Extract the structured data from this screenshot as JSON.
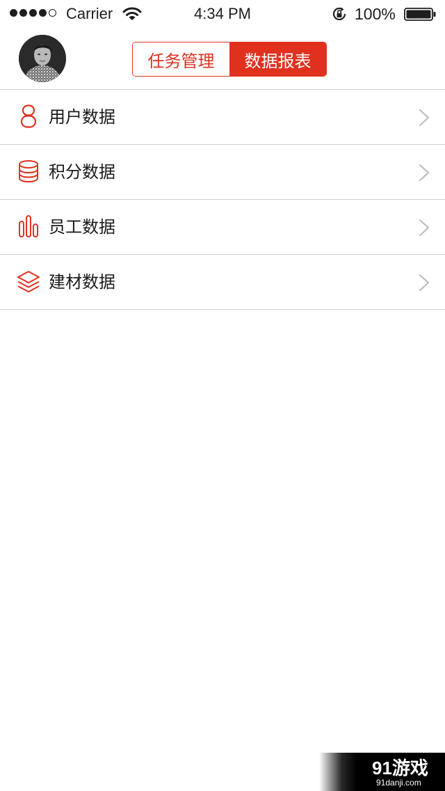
{
  "status_bar": {
    "carrier": "Carrier",
    "time": "4:34 PM",
    "battery": "100%",
    "signal_bars_filled": 4,
    "signal_bars_total": 5
  },
  "header": {
    "avatar_icon": "user-avatar-photo",
    "tabs": [
      {
        "label": "任务管理",
        "active": false
      },
      {
        "label": "数据报表",
        "active": true
      }
    ]
  },
  "menu": {
    "items": [
      {
        "label": "用户数据",
        "icon": "user-icon"
      },
      {
        "label": "积分数据",
        "icon": "database-icon"
      },
      {
        "label": "员工数据",
        "icon": "bar-chart-icon"
      },
      {
        "label": "建材数据",
        "icon": "layers-icon"
      }
    ]
  },
  "watermark": {
    "brand": "91游戏",
    "site": "91danji.com"
  },
  "colors": {
    "accent": "#e0311f",
    "divider": "#d2d2d2",
    "text": "#1a1a1a",
    "chevron": "#bdbdbd"
  }
}
